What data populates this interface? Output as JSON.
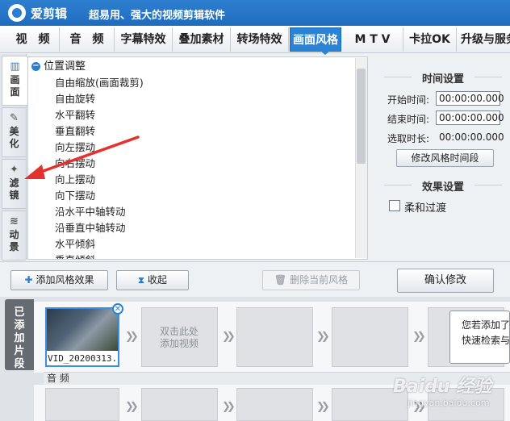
{
  "app": {
    "name": "爱剪辑",
    "slogan": "超易用、强大的视频剪辑软件"
  },
  "tabs": [
    {
      "label": "视　频",
      "active": false
    },
    {
      "label": "音　频",
      "active": false
    },
    {
      "label": "字幕特效",
      "active": false
    },
    {
      "label": "叠加素材",
      "active": false
    },
    {
      "label": "转场特效",
      "active": false
    },
    {
      "label": "画面风格",
      "active": true
    },
    {
      "label": "M T V",
      "active": false
    },
    {
      "label": "卡拉OK",
      "active": false
    },
    {
      "label": "升级与服务",
      "active": false
    }
  ],
  "side_tabs": [
    {
      "label": "画面",
      "icon": "film-icon",
      "active": true
    },
    {
      "label": "美化",
      "icon": "magic-wand-icon",
      "active": false
    },
    {
      "label": "滤镜",
      "icon": "sparkle-wand-icon",
      "active": false
    },
    {
      "label": "动景",
      "icon": "wave-icon",
      "active": false
    }
  ],
  "effects_list": {
    "group": "位置调整",
    "items": [
      "自由缩放(画面裁剪)",
      "自由旋转",
      "水平翻转",
      "垂直翻转",
      "向左摆动",
      "向右摆动",
      "向上摆动",
      "向下摆动",
      "沿水平中轴转动",
      "沿垂直中轴转动",
      "水平倾斜",
      "垂直倾斜"
    ]
  },
  "time_settings": {
    "title": "时间设置",
    "start_label": "开始时间:",
    "start_value": "00:00:00.000",
    "end_label": "结束时间:",
    "end_value": "00:00:00.000",
    "duration_label": "选取时长:",
    "duration_value": "00:00:00.000",
    "modify_button": "修改风格时间段"
  },
  "effect_settings": {
    "title": "效果设置",
    "soft_transition": "柔和过渡",
    "soft_checked": false
  },
  "buttons": {
    "add_effect": "添加风格效果",
    "collapse": "收起",
    "delete_current": "删除当前风格",
    "confirm": "确认修改"
  },
  "timeline": {
    "added_tab": "已添加片段",
    "clip_label": "VID_20200313...",
    "add_video_hint": "双击此处\n添加视频",
    "audio_label": "音 频",
    "tooltip_lines": [
      "您若添加了",
      "快速检索与"
    ]
  },
  "watermark": {
    "text": "Baidu 经验",
    "sub": "jingyan.baidu.com"
  },
  "colors": {
    "accent": "#2b83d6",
    "titlebar": "#1f6cbd",
    "annotation_arrow": "#e5312d"
  }
}
